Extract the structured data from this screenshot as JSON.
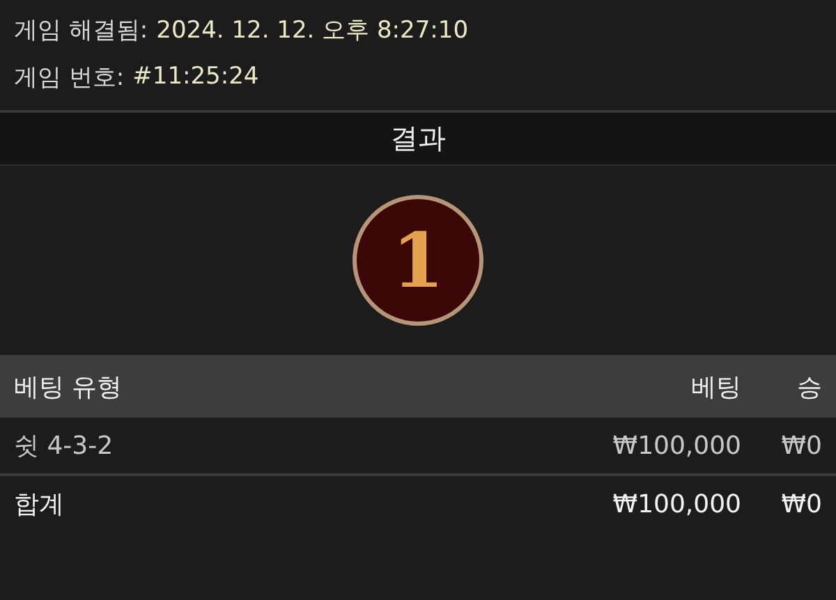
{
  "info": [
    {
      "label": "게임 해결됨:",
      "value": "2024. 12. 12. 오후 8:27:10"
    },
    {
      "label": "게임 번호:",
      "value": "#11:25:24"
    }
  ],
  "result": {
    "title": "결과",
    "number": "1"
  },
  "table": {
    "columns": [
      "베팅 유형",
      "베팅",
      "승"
    ],
    "rows": [
      {
        "kind": "bet",
        "cells": [
          "쉿 4-3-2",
          "₩100,000",
          "₩0"
        ]
      },
      {
        "kind": "total",
        "cells": [
          "합계",
          "₩100,000",
          "₩0"
        ]
      }
    ]
  }
}
